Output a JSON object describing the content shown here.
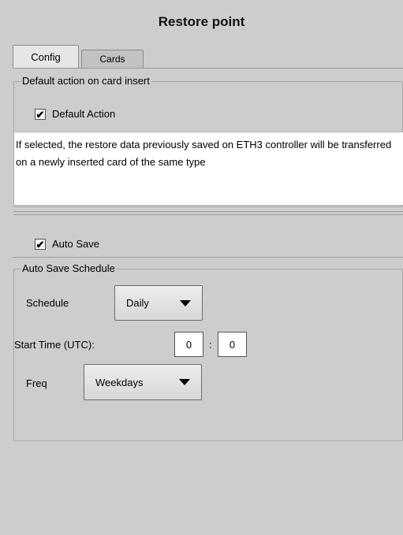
{
  "title": "Restore point",
  "tabs": [
    {
      "label": "Config",
      "active": true
    },
    {
      "label": "Cards",
      "active": false
    }
  ],
  "default_action_group": {
    "legend": "Default action on card insert",
    "checkbox_label": "Default Action",
    "checked": true,
    "description": "If selected, the restore data previously saved on ETH3 controller will be transferred on a newly inserted card of the same type"
  },
  "auto_save": {
    "checkbox_label": "Auto Save",
    "checked": true
  },
  "schedule_group": {
    "legend": "Auto Save Schedule",
    "schedule_label": "Schedule",
    "schedule_value": "Daily",
    "start_time_label": "Start Time (UTC):",
    "hour": "0",
    "separator": ":",
    "minute": "0",
    "freq_label": "Freq",
    "freq_value": "Weekdays"
  },
  "check_glyph": "✔",
  "icons": {
    "check": "checkmark-icon",
    "dropdown": "triangle-down-icon"
  }
}
